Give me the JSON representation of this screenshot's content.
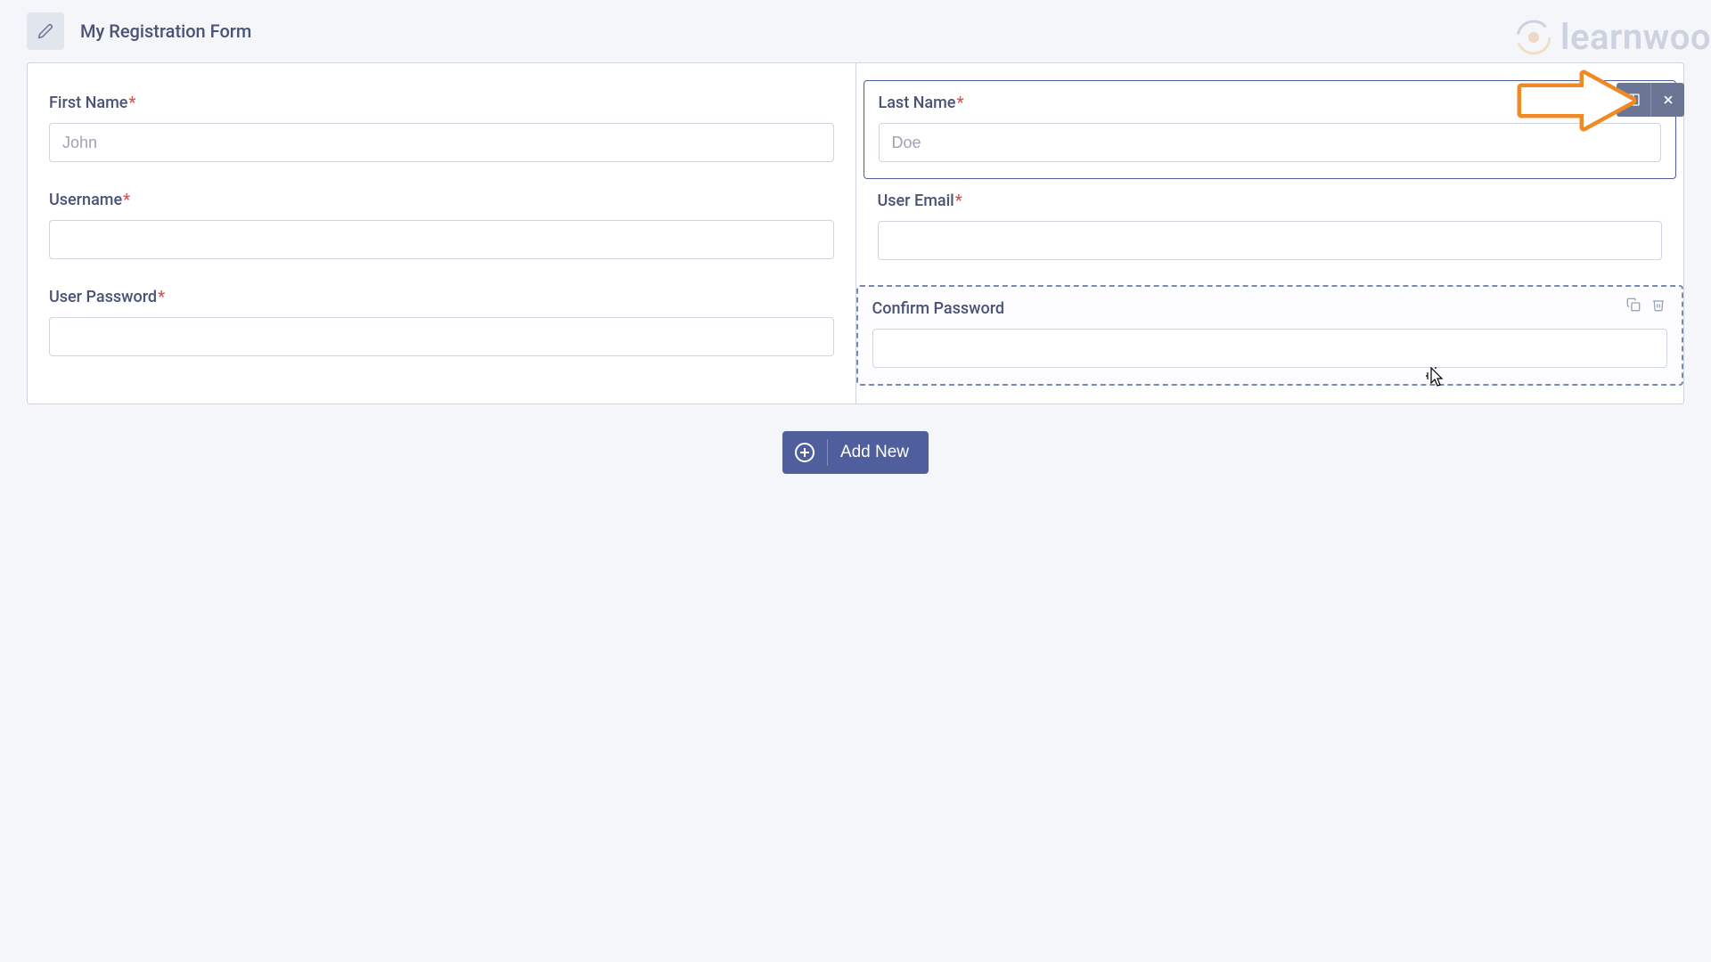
{
  "header": {
    "title": "My Registration Form"
  },
  "columns": {
    "left": {
      "fields": [
        {
          "label": "First Name",
          "required": true,
          "placeholder": "John"
        },
        {
          "label": "Username",
          "required": true,
          "placeholder": ""
        },
        {
          "label": "User Password",
          "required": true,
          "placeholder": ""
        }
      ]
    },
    "right": {
      "fields": [
        {
          "label": "Last Name",
          "required": true,
          "placeholder": "Doe",
          "state": "selected"
        },
        {
          "label": "User Email",
          "required": true,
          "placeholder": ""
        },
        {
          "label": "Confirm Password",
          "required": false,
          "placeholder": "",
          "state": "dragging"
        }
      ]
    }
  },
  "actions": {
    "add_new": "Add New"
  },
  "branding": {
    "logo_text": "learnwoo"
  }
}
